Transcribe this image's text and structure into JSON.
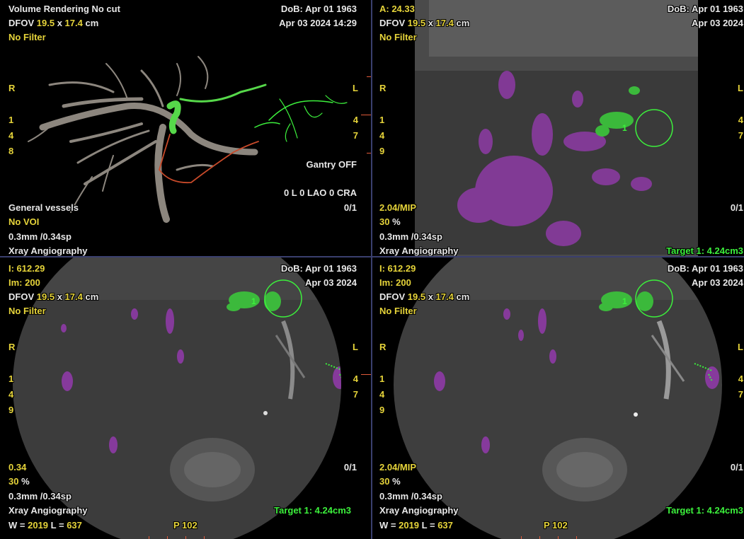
{
  "top_left": {
    "title": "Volume Rendering No cut",
    "dfov_label": "DFOV",
    "dfov_w": "19.5",
    "dfov_x": "x",
    "dfov_h": "17.4",
    "dfov_unit": "cm",
    "filter": "No Filter",
    "dob": "DoB: Apr 01 1963",
    "date": "Apr 03 2024 14:29",
    "orient_r": "R",
    "orient_l": "L",
    "left_nums": [
      "1",
      "4",
      "8"
    ],
    "right_nums": [
      "4",
      "7"
    ],
    "gantry": "Gantry OFF",
    "angle": "0 L 0 LAO 0 CRA",
    "protocol": "General vessels",
    "voi": "No VOI",
    "slice": "0.3mm /0.34sp",
    "modality": "Xray Angiography",
    "frame": "0/1"
  },
  "top_right": {
    "header": "A: 24.33",
    "dfov_label": "DFOV",
    "dfov_w": "19.5",
    "dfov_x": "x",
    "dfov_h": "17.4",
    "dfov_unit": "cm",
    "filter": "No Filter",
    "dob": "DoB: Apr 01 1963",
    "date": "Apr 03 2024",
    "orient_r": "R",
    "orient_l": "L",
    "left_nums": [
      "1",
      "4",
      "9"
    ],
    "right_nums": [
      "4",
      "7"
    ],
    "thickness": "2.04/MIP",
    "percent": "30",
    "percent_unit": "%",
    "slice": "0.3mm /0.34sp",
    "modality": "Xray Angiography",
    "frame": "0/1",
    "target": "Target 1: 4.24cm3",
    "target_marker": "1"
  },
  "bottom_left": {
    "header": "I: 612.29",
    "im_label": "Im:",
    "im_value": "200",
    "dfov_label": "DFOV",
    "dfov_w": "19.5",
    "dfov_x": "x",
    "dfov_h": "17.4",
    "dfov_unit": "cm",
    "filter": "No Filter",
    "dob": "DoB: Apr 01 1963",
    "date": "Apr 03 2024",
    "orient_r": "R",
    "orient_l": "L",
    "left_nums": [
      "1",
      "4",
      "9"
    ],
    "right_nums": [
      "4",
      "7"
    ],
    "thickness": "0.34",
    "percent": "30",
    "percent_unit": "%",
    "slice": "0.3mm /0.34sp",
    "modality": "Xray Angiography",
    "wl_w": "W =",
    "wl_w_val": "2019",
    "wl_l": "L =",
    "wl_l_val": "637",
    "frame": "0/1",
    "target": "Target 1: 4.24cm3",
    "target_marker": "1",
    "position": "P 102"
  },
  "bottom_right": {
    "header": "I: 612.29",
    "im_label": "Im:",
    "im_value": "200",
    "dfov_label": "DFOV",
    "dfov_w": "19.5",
    "dfov_x": "x",
    "dfov_h": "17.4",
    "dfov_unit": "cm",
    "filter": "No Filter",
    "dob": "DoB: Apr 01 1963",
    "date": "Apr 03 2024",
    "orient_r": "R",
    "orient_l": "L",
    "left_nums": [
      "1",
      "4",
      "9"
    ],
    "right_nums": [
      "4",
      "7"
    ],
    "thickness": "2.04/MIP",
    "percent": "30",
    "percent_unit": "%",
    "slice": "0.3mm /0.34sp",
    "modality": "Xray Angiography",
    "wl_w": "W =",
    "wl_w_val": "2019",
    "wl_l": "L =",
    "wl_l_val": "637",
    "frame": "0/1",
    "target": "Target 1: 4.24cm3",
    "target_marker": "1",
    "position": "P 102"
  },
  "colors": {
    "label_yellow": "#e6d43a",
    "label_white": "#e8e8e8",
    "target_green": "#3cf03c",
    "feeder_purple": "#9a3fb0",
    "divider": "#3a3f6e"
  }
}
